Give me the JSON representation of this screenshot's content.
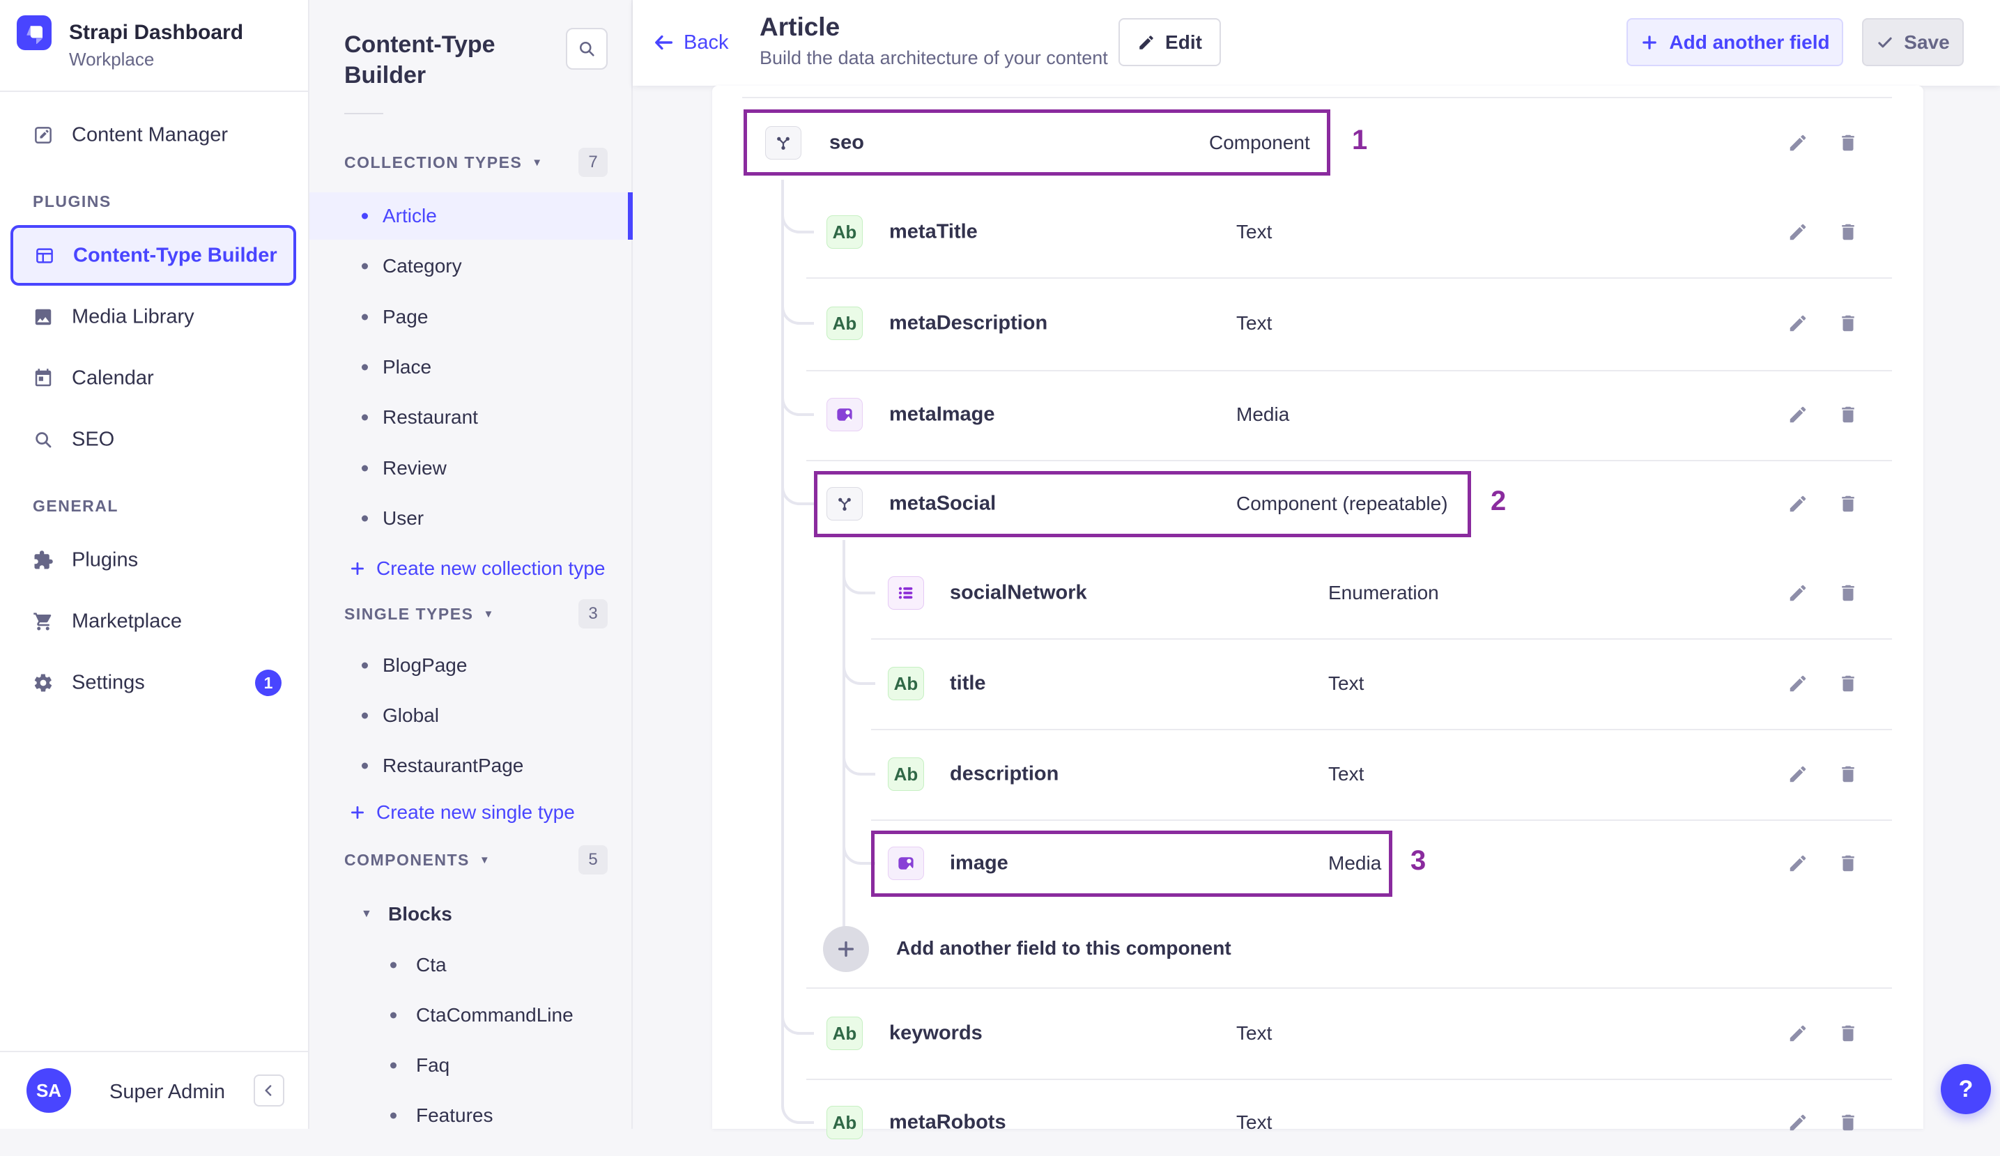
{
  "colors": {
    "primary": "#4945ff",
    "annotation": "#8a2b9e",
    "text": "#32324d",
    "muted": "#666687",
    "selected_bg": "#f0f0ff"
  },
  "app": {
    "name": "Strapi Dashboard",
    "workspace": "Workplace"
  },
  "main_nav": {
    "top_items": [
      {
        "label": "Content Manager",
        "icon": "compose-icon"
      }
    ],
    "sections": [
      {
        "label": "PLUGINS",
        "items": [
          {
            "label": "Content-Type Builder",
            "icon": "layout-icon",
            "active": true
          },
          {
            "label": "Media Library",
            "icon": "image-icon"
          },
          {
            "label": "Calendar",
            "icon": "calendar-icon"
          },
          {
            "label": "SEO",
            "icon": "search-icon"
          }
        ]
      },
      {
        "label": "GENERAL",
        "items": [
          {
            "label": "Plugins",
            "icon": "puzzle-icon"
          },
          {
            "label": "Marketplace",
            "icon": "cart-icon"
          },
          {
            "label": "Settings",
            "icon": "gear-icon",
            "badge": "1"
          }
        ]
      }
    ],
    "user": {
      "initials": "SA",
      "name": "Super Admin"
    }
  },
  "builder_nav": {
    "title": "Content-Type Builder",
    "sections": [
      {
        "label": "COLLECTION TYPES",
        "count": "7",
        "items": [
          {
            "label": "Article",
            "active": true
          },
          {
            "label": "Category"
          },
          {
            "label": "Page"
          },
          {
            "label": "Place"
          },
          {
            "label": "Restaurant"
          },
          {
            "label": "Review"
          },
          {
            "label": "User"
          }
        ],
        "create_label": "Create new collection type"
      },
      {
        "label": "SINGLE TYPES",
        "count": "3",
        "items": [
          {
            "label": "BlogPage"
          },
          {
            "label": "Global"
          },
          {
            "label": "RestaurantPage"
          }
        ],
        "create_label": "Create new single type"
      },
      {
        "label": "COMPONENTS",
        "count": "5",
        "groups": [
          {
            "label": "Blocks",
            "items": [
              {
                "label": "Cta"
              },
              {
                "label": "CtaCommandLine"
              },
              {
                "label": "Faq"
              },
              {
                "label": "Features"
              }
            ]
          }
        ]
      }
    ]
  },
  "header": {
    "back_label": "Back",
    "title": "Article",
    "subtitle": "Build the data architecture of your content",
    "edit_label": "Edit",
    "add_field_label": "Add another field",
    "save_label": "Save"
  },
  "content": {
    "text_icon_glyph": "Ab",
    "rows": [
      {
        "name": "seo",
        "type": "Component",
        "level": 0,
        "icon": "component-icon",
        "annotation": "1"
      },
      {
        "name": "metaTitle",
        "type": "Text",
        "level": 1,
        "icon": "text-icon"
      },
      {
        "name": "metaDescription",
        "type": "Text",
        "level": 1,
        "icon": "text-icon"
      },
      {
        "name": "metaImage",
        "type": "Media",
        "level": 1,
        "icon": "media-icon"
      },
      {
        "name": "metaSocial",
        "type": "Component (repeatable)",
        "level": 1,
        "icon": "component-icon",
        "annotation": "2"
      },
      {
        "name": "socialNetwork",
        "type": "Enumeration",
        "level": 2,
        "icon": "enum-icon"
      },
      {
        "name": "title",
        "type": "Text",
        "level": 2,
        "icon": "text-icon"
      },
      {
        "name": "description",
        "type": "Text",
        "level": 2,
        "icon": "text-icon"
      },
      {
        "name": "image",
        "type": "Media",
        "level": 2,
        "icon": "media-icon",
        "annotation": "3"
      },
      {
        "name": "keywords",
        "type": "Text",
        "level": 1,
        "icon": "text-icon"
      },
      {
        "name": "metaRobots",
        "type": "Text",
        "level": 1,
        "icon": "text-icon"
      }
    ],
    "add_field_row_label": "Add another field to this component"
  },
  "help_label": "?"
}
